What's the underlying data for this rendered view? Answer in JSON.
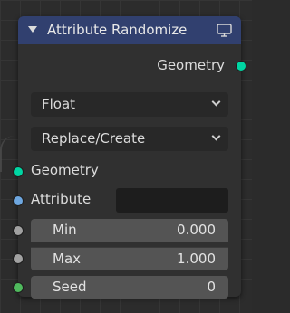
{
  "colors": {
    "header": "#31406f",
    "geometry_socket": "#00d6a3",
    "attribute_socket": "#6ea7e0",
    "float_socket": "#a1a1a1",
    "int_socket": "#4fb95d"
  },
  "node": {
    "title": "Attribute Randomize",
    "collapse_icon": "triangle-down-icon",
    "preview_icon": "monitor-icon",
    "outputs": [
      {
        "label": "Geometry",
        "socket": "geometry"
      }
    ],
    "dropdowns": [
      {
        "value": "Float"
      },
      {
        "value": "Replace/Create"
      }
    ],
    "inputs": {
      "geometry": {
        "label": "Geometry"
      },
      "attribute": {
        "label": "Attribute",
        "value": ""
      },
      "min": {
        "label": "Min",
        "value": "0.000"
      },
      "max": {
        "label": "Max",
        "value": "1.000"
      },
      "seed": {
        "label": "Seed",
        "value": "0"
      }
    }
  }
}
